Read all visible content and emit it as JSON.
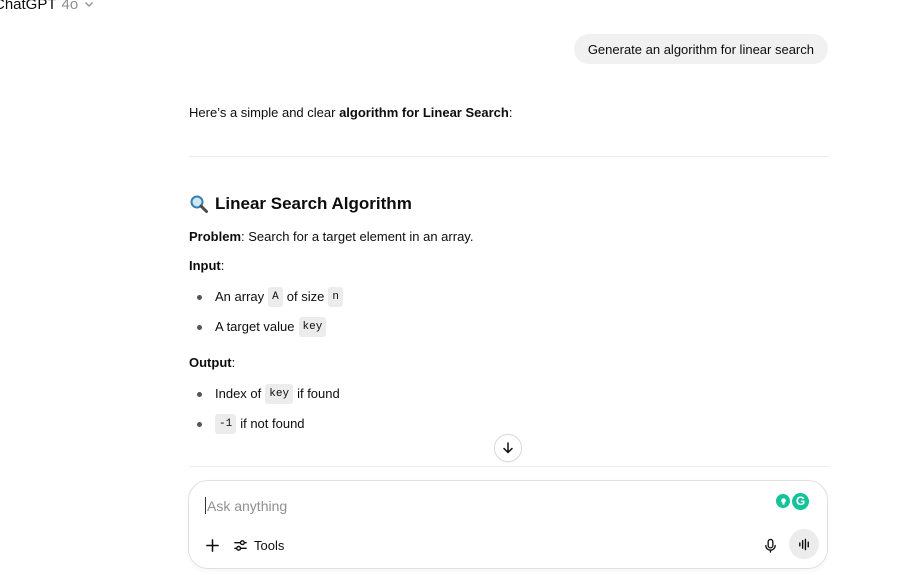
{
  "header": {
    "app_name": "ChatGPT",
    "model_version": "4o"
  },
  "conversation": {
    "user_message": "Generate an algorithm for linear search",
    "intro_text": "Here’s a simple and clear ",
    "intro_bold": "algorithm for Linear Search",
    "intro_end": ":",
    "heading": "Linear Search Algorithm",
    "heading_icon": "magnifying-glass-emoji",
    "problem_label": "Problem",
    "problem_text": ": Search for a target element in an array.",
    "input_label": "Input",
    "input_colon": ":",
    "input_items": [
      {
        "pre": "An array",
        "code1": "A",
        "mid": "of size",
        "code2": "n"
      },
      {
        "pre": "A target value",
        "code1": "key"
      }
    ],
    "output_label": "Output",
    "output_colon": ":",
    "output_items": [
      {
        "pre": "Index of",
        "code1": "key",
        "post": "if found"
      },
      {
        "code1": "-1",
        "post": "if not found"
      }
    ]
  },
  "composer": {
    "placeholder": "Ask anything",
    "tools_label": "Tools"
  },
  "colors": {
    "bubble_bg": "#f1f1f1",
    "accent_green": "#15c39a",
    "muted": "#8f8f8f"
  }
}
